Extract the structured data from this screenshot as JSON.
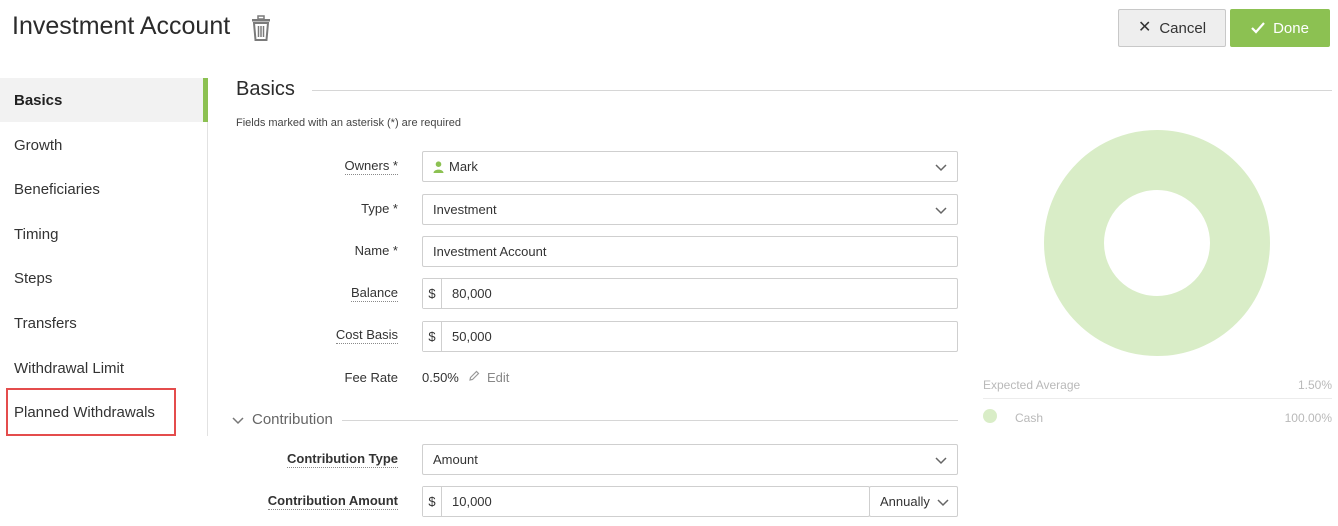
{
  "header": {
    "title": "Investment Account",
    "cancel_label": "Cancel",
    "done_label": "Done",
    "accent_color": "#8cc152"
  },
  "sidebar": {
    "items": [
      {
        "label": "Basics",
        "active": true
      },
      {
        "label": "Growth"
      },
      {
        "label": "Beneficiaries"
      },
      {
        "label": "Timing"
      },
      {
        "label": "Steps"
      },
      {
        "label": "Transfers"
      },
      {
        "label": "Withdrawal Limit"
      },
      {
        "label": "Planned Withdrawals",
        "highlighted": true
      }
    ]
  },
  "main": {
    "section_title": "Basics",
    "required_note": "Fields marked with an asterisk (*) are required",
    "fields": {
      "owners": {
        "label": "Owners *",
        "value": "Mark"
      },
      "type": {
        "label": "Type *",
        "value": "Investment"
      },
      "name": {
        "label": "Name *",
        "value": "Investment Account"
      },
      "balance": {
        "label": "Balance",
        "prefix": "$",
        "value": "80,000"
      },
      "cost_basis": {
        "label": "Cost Basis",
        "prefix": "$",
        "value": "50,000"
      },
      "fee_rate": {
        "label": "Fee Rate",
        "value": "0.50%",
        "edit_label": "Edit"
      }
    },
    "contribution": {
      "title": "Contribution",
      "type": {
        "label": "Contribution Type",
        "value": "Amount"
      },
      "amount": {
        "label": "Contribution Amount",
        "prefix": "$",
        "value": "10,000",
        "frequency": "Annually"
      }
    }
  },
  "allocation": {
    "expected_label": "Expected Average",
    "expected_value": "1.50%",
    "items": [
      {
        "name": "Cash",
        "percent": "100.00%",
        "color": "#d9edc7"
      }
    ]
  }
}
